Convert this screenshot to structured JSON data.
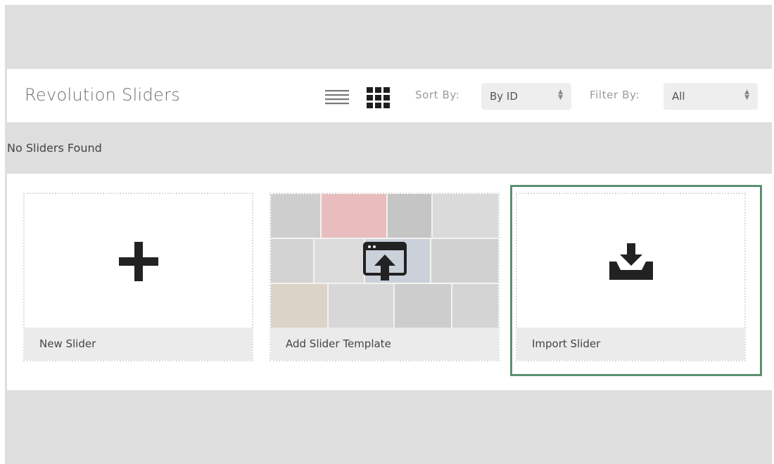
{
  "header": {
    "title": "Revolution Sliders",
    "view_list_icon": "list-view-icon",
    "view_grid_icon": "grid-view-icon",
    "sort_label": "Sort By:",
    "sort_value": "By ID",
    "filter_label": "Filter By:",
    "filter_value": "All"
  },
  "status": {
    "message": "No Sliders Found"
  },
  "cards": [
    {
      "label": "New Slider",
      "icon": "plus-icon"
    },
    {
      "label": "Add Slider Template",
      "icon": "template-upload-icon"
    },
    {
      "label": "Import Slider",
      "icon": "import-download-icon"
    }
  ],
  "colors": {
    "background": "#dedede",
    "selected_border": "#5c8f70",
    "card_footer": "#ebebeb"
  }
}
